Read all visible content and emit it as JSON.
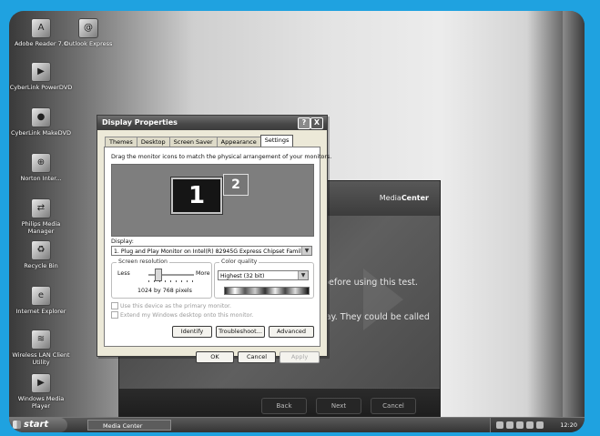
{
  "desktop_icons": [
    {
      "label": "Adobe Reader 7.0",
      "icon": "adobe-reader-icon",
      "glyph": "A"
    },
    {
      "label": "Outlook Express",
      "icon": "outlook-express-icon",
      "glyph": "@"
    },
    {
      "label": "CyberLink PowerDVD",
      "icon": "powerdvd-icon",
      "glyph": "▶"
    },
    {
      "label": "CyberLink MakeDVD",
      "icon": "makedvd-icon",
      "glyph": "●"
    },
    {
      "label": "Norton Inter...",
      "icon": "norton-icon",
      "glyph": "⊕"
    },
    {
      "label": "Philips Media Manager",
      "icon": "media-manager-icon",
      "glyph": "⇄"
    },
    {
      "label": "Recycle Bin",
      "icon": "recycle-bin-icon",
      "glyph": "♻"
    },
    {
      "label": "Internet Explorer",
      "icon": "internet-explorer-icon",
      "glyph": "e"
    },
    {
      "label": "Wireless LAN Client Utility",
      "icon": "wireless-lan-icon",
      "glyph": "≋"
    },
    {
      "label": "Windows Media Player",
      "icon": "media-player-icon",
      "glyph": "▶"
    }
  ],
  "media_center": {
    "logo_prefix": "Media",
    "logo_bold": "Center",
    "line1": "before using this test.",
    "line2": "lay. They could be called",
    "buttons": {
      "back": "Back",
      "next": "Next",
      "cancel": "Cancel"
    }
  },
  "dialog": {
    "title": "Display Properties",
    "help_glyph": "?",
    "close_glyph": "X",
    "tabs": [
      "Themes",
      "Desktop",
      "Screen Saver",
      "Appearance",
      "Settings"
    ],
    "active_tab": "Settings",
    "instruction": "Drag the monitor icons to match the physical arrangement of your monitors.",
    "monitor1": "1",
    "monitor2": "2",
    "display_label": "Display:",
    "display_value": "1. Plug and Play Monitor on Intel(R) 82945G Express Chipset Family",
    "resolution": {
      "group_label": "Screen resolution",
      "less": "Less",
      "more": "More",
      "value": "1024 by 768 pixels",
      "level": 0.2
    },
    "color": {
      "group_label": "Color quality",
      "value": "Highest (32 bit)"
    },
    "check_primary": "Use this device as the primary monitor.",
    "check_extend": "Extend my Windows desktop onto this monitor.",
    "buttons": {
      "identify": "Identify",
      "troubleshoot": "Troubleshoot...",
      "advanced": "Advanced",
      "ok": "OK",
      "cancel": "Cancel",
      "apply": "Apply"
    },
    "dropdown_arrow": "▼"
  },
  "taskbar": {
    "start_label": "start",
    "task_label": "Media Center",
    "clock": "12:20"
  }
}
